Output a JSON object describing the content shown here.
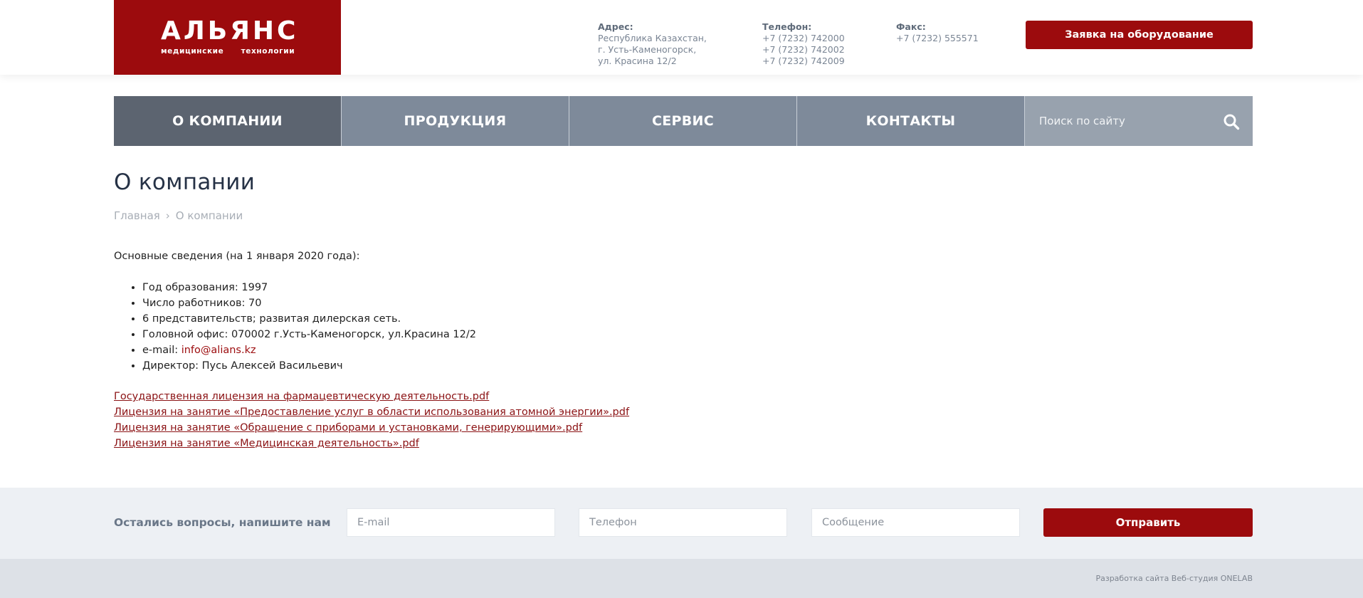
{
  "header": {
    "logo": {
      "title": "АЛЬЯНС",
      "subtitle": "медицинские технологии"
    },
    "address": {
      "label": "Адрес:",
      "lines": [
        "Республика Казахстан,",
        "г. Усть-Каменогорск,",
        "ул. Красина 12/2"
      ]
    },
    "phone": {
      "label": "Телефон:",
      "lines": [
        "+7 (7232) 742000",
        "+7 (7232) 742002",
        "+7 (7232) 742009"
      ]
    },
    "fax": {
      "label": "Факс:",
      "value": "+7 (7232) 555571"
    },
    "request_button": "Заявка на оборудование"
  },
  "nav": {
    "items": [
      {
        "label": "О КОМПАНИИ",
        "active": true
      },
      {
        "label": "ПРОДУКЦИЯ",
        "active": false
      },
      {
        "label": "СЕРВИС",
        "active": false
      },
      {
        "label": "КОНТАКТЫ",
        "active": false
      }
    ],
    "search_placeholder": "Поиск по сайту",
    "search_icon": "search-icon"
  },
  "content": {
    "title": "О компании",
    "breadcrumb": {
      "home": "Главная",
      "separator": "›",
      "current": "О компании"
    },
    "intro": "Основные сведения (на 1 января 2020 года):",
    "facts": [
      "Год образования: 1997",
      "Число работников: 70",
      "6 представительств; развитая дилерская сеть.",
      "Головной офис: 070002 г.Усть-Каменогорск, ул.Красина 12/2",
      {
        "prefix": "e-mail: ",
        "link": "info@alians.kz"
      },
      "Директор: Пусь Алексей Васильевич"
    ],
    "documents": [
      "Государственная лицензия на фармацевтическую деятельность.pdf",
      "Лицензия на занятие «Предоставление услуг в области использования атомной энергии».pdf",
      "Лицензия на занятие «Обращение с приборами и установками, генерирующими».pdf",
      "Лицензия на занятие «Медицинская деятельность».pdf"
    ]
  },
  "contact_form": {
    "label": "Остались вопросы, напишите нам",
    "email_placeholder": "E-mail",
    "phone_placeholder": "Телефон",
    "message_placeholder": "Сообщение",
    "submit_label": "Отправить"
  },
  "footer": {
    "credit": "Разработка сайта Веб-студия ONELAB"
  },
  "colors": {
    "brand": "#9c0b0d",
    "nav": "#7e8a9a",
    "nav_active": "#5c6470",
    "search_bg": "#98a2ae"
  }
}
